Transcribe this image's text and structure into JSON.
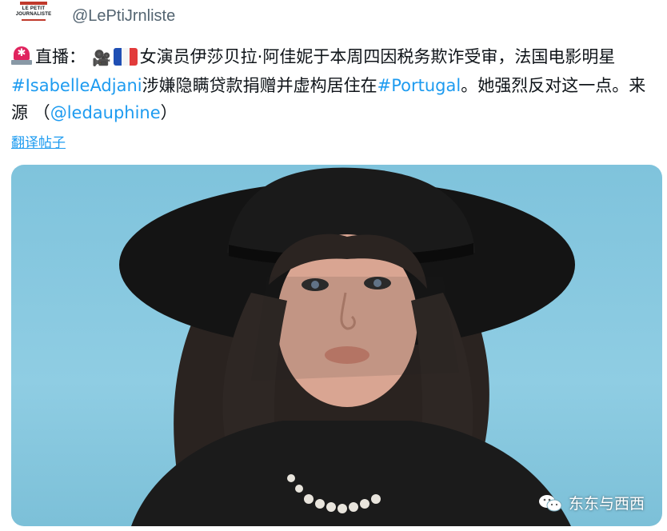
{
  "account": {
    "logo_line1": "LE PETIT",
    "logo_line2": "JOURNALISTE",
    "handle": "@LePtiJrnliste"
  },
  "tweet": {
    "prefix": "直播：",
    "text_part1": "女演员伊莎贝拉·阿佳妮于本周四因税务欺诈受审，法国电影明星",
    "hashtag1": "#IsabelleAdjani",
    "text_part2": "涉嫌隐瞒贷款捐赠并虚构居住在",
    "hashtag2": "#Portugal",
    "text_part3": "。她强烈反对这一点。来源 （",
    "mention": "@ledauphine",
    "text_part4": "）",
    "icons": [
      "siren-icon",
      "movie-camera-icon",
      "french-flag-icon"
    ]
  },
  "translate_link": "翻译帖子",
  "media": {
    "description_icon": "photo",
    "watermark": "东东与西西",
    "watermark_icon": "wechat-icon"
  },
  "colors": {
    "link": "#1d9bf0",
    "text": "#0f1419",
    "muted": "#536471",
    "background_photo": "#86c8df"
  }
}
